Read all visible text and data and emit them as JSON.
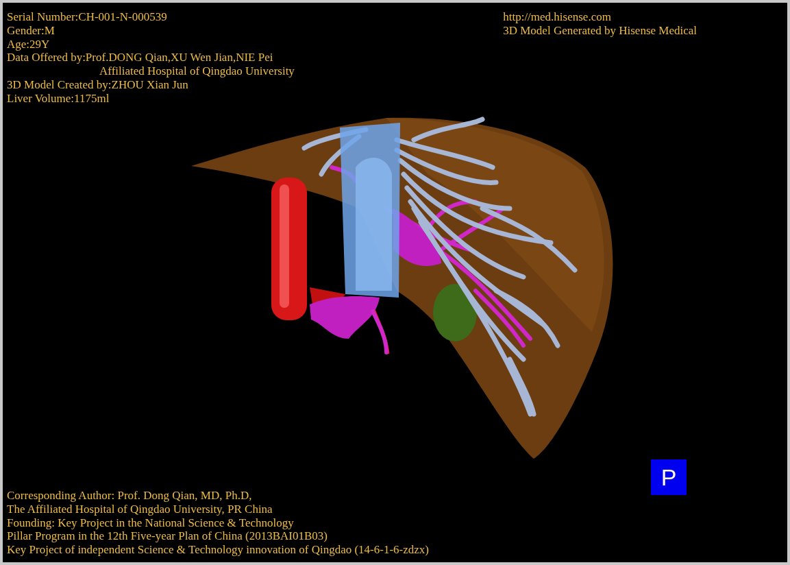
{
  "patient_info": [
    {
      "kind": "line",
      "text": "Serial Number:CH-001-N-000539"
    },
    {
      "kind": "line",
      "text": "Gender:M"
    },
    {
      "kind": "line",
      "text": "Age:29Y"
    },
    {
      "kind": "line",
      "text": "Data Offered by:Prof.DONG Qian,XU Wen Jian,NIE Pei"
    },
    {
      "kind": "continuation",
      "text": "Affiliated Hospital of Qingdao University"
    },
    {
      "kind": "line",
      "text": "3D Model Created by:ZHOU Xian Jun"
    },
    {
      "kind": "line",
      "text": "Liver Volume:1175ml"
    }
  ],
  "credits": [
    "http://med.hisense.com",
    "3D Model Generated by Hisense Medical"
  ],
  "orientation_label": "P",
  "footer": [
    "Corresponding Author: Prof. Dong Qian, MD, Ph.D,",
    "The Affiliated Hospital of Qingdao University, PR China",
    "Founding: Key Project in the National Science & Technology",
    "Pillar Program in the 12th Five-year Plan of China (2013BAI01B03)",
    "Key Project of independent Science & Technology innovation of Qingdao (14-6-1-6-zdzx)"
  ]
}
